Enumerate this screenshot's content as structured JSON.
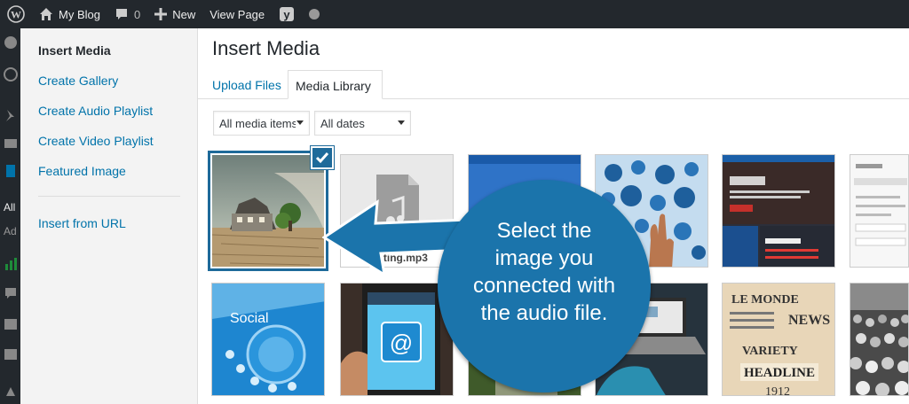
{
  "admin_bar": {
    "site_name": "My Blog",
    "comments_count": "0",
    "new_label": "New",
    "view_page_label": "View Page"
  },
  "admin_menu": {
    "visible_text_1": "All",
    "visible_text_2": "Ad"
  },
  "media_menu": {
    "items": [
      {
        "label": "Insert Media",
        "active": true
      },
      {
        "label": "Create Gallery"
      },
      {
        "label": "Create Audio Playlist"
      },
      {
        "label": "Create Video Playlist"
      },
      {
        "label": "Featured Image"
      },
      {
        "label": "Insert from URL"
      }
    ]
  },
  "frame": {
    "title": "Insert Media",
    "tabs": [
      {
        "label": "Upload Files"
      },
      {
        "label": "Media Library",
        "active": true
      }
    ]
  },
  "filters": {
    "media_type": "All media items",
    "dates": "All dates"
  },
  "attachments": {
    "audio_file_name": "Testing.mp3"
  },
  "callout": {
    "lines": [
      "Select the",
      "image you",
      "connected with",
      "the audio file."
    ],
    "color": "#1b74ab"
  },
  "colors": {
    "link": "#0073aa",
    "selection": "#1e6a9a",
    "admin_bar": "#23282d"
  }
}
